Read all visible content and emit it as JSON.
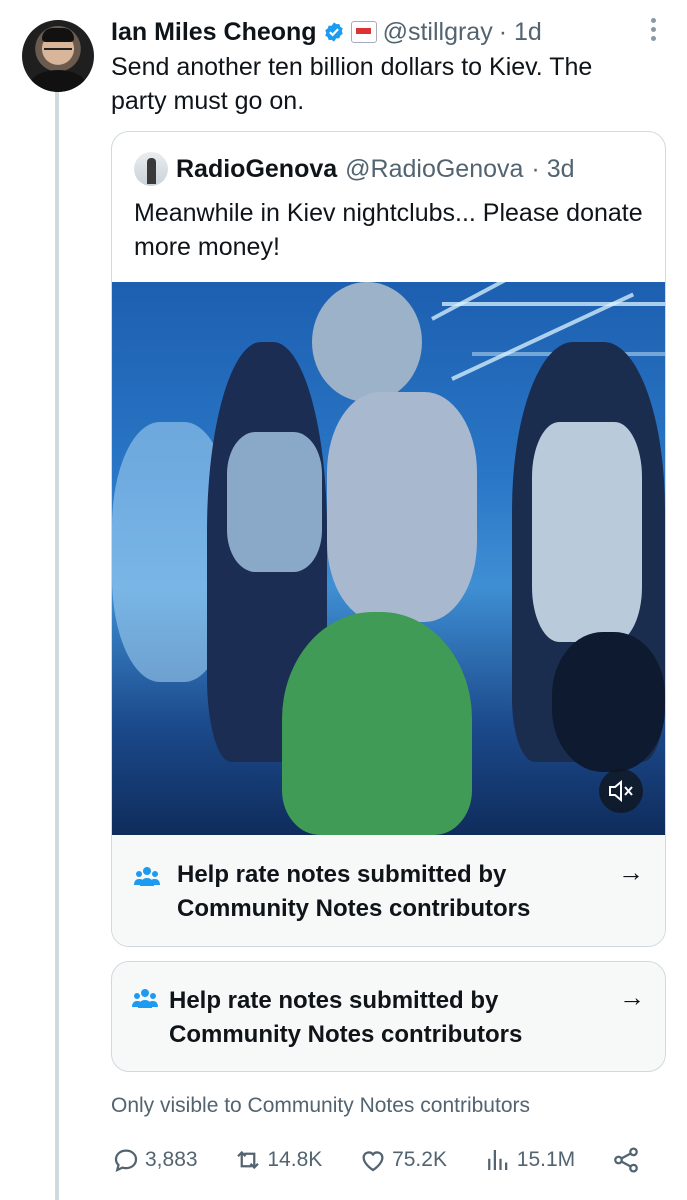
{
  "tweet": {
    "author_name": "Ian Miles Cheong",
    "handle": "@stillgray",
    "time": "· 1d",
    "text": "Send another ten billion dollars to Kiev. The party must go on."
  },
  "quoted_tweet": {
    "author_name": "RadioGenova",
    "handle": "@RadioGenova",
    "time": "· 3d",
    "text": "Meanwhile in Kiev nightclubs... Please donate more money!"
  },
  "community_notes": {
    "inner_label": "Help rate notes submitted by Community Notes contributors",
    "outer_label": "Help rate notes submitted by Community Notes contributors",
    "arrow": "→",
    "visibility_note": "Only visible to Community Notes contributors"
  },
  "stats": {
    "replies": "3,883",
    "reposts": "14.8K",
    "likes": "75.2K",
    "views": "15.1M"
  },
  "colors": {
    "accent": "#1d9bf0",
    "muted": "#536471",
    "border": "#cfd9de"
  },
  "icons": [
    "verified-badge-icon",
    "affiliate-badge-icon",
    "more-icon",
    "mute-icon",
    "community-notes-icon",
    "arrow-right-icon",
    "reply-icon",
    "repost-icon",
    "like-icon",
    "views-icon",
    "share-icon"
  ]
}
